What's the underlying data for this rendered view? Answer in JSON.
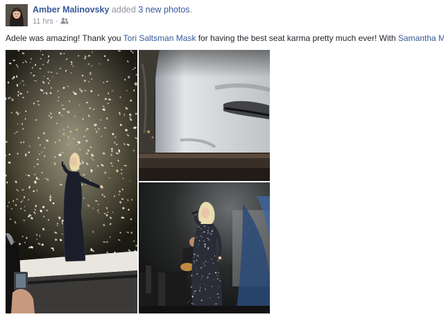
{
  "header": {
    "author": "Amber Malinovsky",
    "added_text": "added",
    "photos_link": "3 new photos",
    "period": ".",
    "timestamp": "11 hrs",
    "separator": "·",
    "audience_icon": "friends-icon"
  },
  "post": {
    "segments": [
      {
        "text": "Adele was amazing! Thank you ",
        "link": false
      },
      {
        "text": "Tori Saltsman Mask",
        "link": true
      },
      {
        "text": " for having the best seat karma pretty much ever! With ",
        "link": false
      },
      {
        "text": "Samantha Mask",
        "link": true
      }
    ]
  },
  "colors": {
    "link": "#365899",
    "meta": "#90949c",
    "text": "#1d2129"
  },
  "photos": [
    {
      "name": "photo-concert-confetti",
      "icon": "photo"
    },
    {
      "name": "photo-screen-eye-closeup",
      "icon": "photo"
    },
    {
      "name": "photo-singer-sequin-dress",
      "icon": "photo"
    }
  ]
}
